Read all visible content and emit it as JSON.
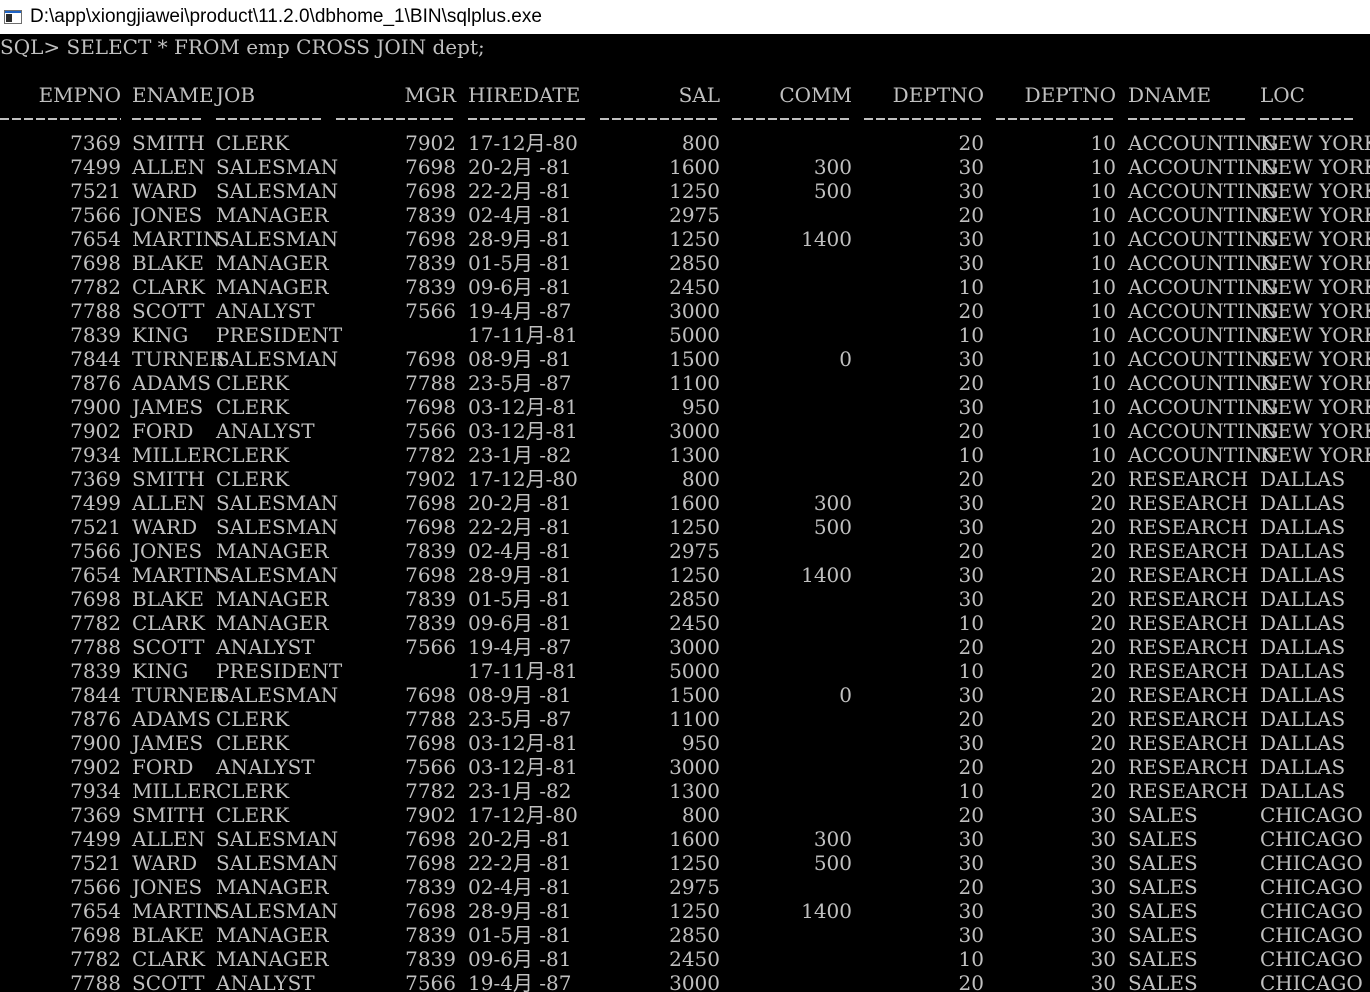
{
  "window": {
    "title": "D:\\app\\xiongjiawei\\product\\11.2.0\\dbhome_1\\BIN\\sqlplus.exe",
    "icon": "console-window-icon",
    "background": "#000000",
    "text_color": "#c0c0c0"
  },
  "console": {
    "prompt_line": "SQL> SELECT * FROM emp CROSS JOIN dept;",
    "headers": [
      "EMPNO",
      "ENAME",
      "JOB",
      "MGR",
      "HIREDATE",
      "SAL",
      "COMM",
      "DEPTNO",
      "DEPTNO",
      "DNAME",
      "LOC"
    ],
    "rows": [
      [
        "7369",
        "SMITH",
        "CLERK",
        "7902",
        "17-12月-80",
        "800",
        "",
        "20",
        "10",
        "ACCOUNTING",
        "NEW YORK"
      ],
      [
        "7499",
        "ALLEN",
        "SALESMAN",
        "7698",
        "20-2月 -81",
        "1600",
        "300",
        "30",
        "10",
        "ACCOUNTING",
        "NEW YORK"
      ],
      [
        "7521",
        "WARD",
        "SALESMAN",
        "7698",
        "22-2月 -81",
        "1250",
        "500",
        "30",
        "10",
        "ACCOUNTING",
        "NEW YORK"
      ],
      [
        "7566",
        "JONES",
        "MANAGER",
        "7839",
        "02-4月 -81",
        "2975",
        "",
        "20",
        "10",
        "ACCOUNTING",
        "NEW YORK"
      ],
      [
        "7654",
        "MARTIN",
        "SALESMAN",
        "7698",
        "28-9月 -81",
        "1250",
        "1400",
        "30",
        "10",
        "ACCOUNTING",
        "NEW YORK"
      ],
      [
        "7698",
        "BLAKE",
        "MANAGER",
        "7839",
        "01-5月 -81",
        "2850",
        "",
        "30",
        "10",
        "ACCOUNTING",
        "NEW YORK"
      ],
      [
        "7782",
        "CLARK",
        "MANAGER",
        "7839",
        "09-6月 -81",
        "2450",
        "",
        "10",
        "10",
        "ACCOUNTING",
        "NEW YORK"
      ],
      [
        "7788",
        "SCOTT",
        "ANALYST",
        "7566",
        "19-4月 -87",
        "3000",
        "",
        "20",
        "10",
        "ACCOUNTING",
        "NEW YORK"
      ],
      [
        "7839",
        "KING",
        "PRESIDENT",
        "",
        "17-11月-81",
        "5000",
        "",
        "10",
        "10",
        "ACCOUNTING",
        "NEW YORK"
      ],
      [
        "7844",
        "TURNER",
        "SALESMAN",
        "7698",
        "08-9月 -81",
        "1500",
        "0",
        "30",
        "10",
        "ACCOUNTING",
        "NEW YORK"
      ],
      [
        "7876",
        "ADAMS",
        "CLERK",
        "7788",
        "23-5月 -87",
        "1100",
        "",
        "20",
        "10",
        "ACCOUNTING",
        "NEW YORK"
      ],
      [
        "7900",
        "JAMES",
        "CLERK",
        "7698",
        "03-12月-81",
        "950",
        "",
        "30",
        "10",
        "ACCOUNTING",
        "NEW YORK"
      ],
      [
        "7902",
        "FORD",
        "ANALYST",
        "7566",
        "03-12月-81",
        "3000",
        "",
        "20",
        "10",
        "ACCOUNTING",
        "NEW YORK"
      ],
      [
        "7934",
        "MILLER",
        "CLERK",
        "7782",
        "23-1月 -82",
        "1300",
        "",
        "10",
        "10",
        "ACCOUNTING",
        "NEW YORK"
      ],
      [
        "7369",
        "SMITH",
        "CLERK",
        "7902",
        "17-12月-80",
        "800",
        "",
        "20",
        "20",
        "RESEARCH",
        "DALLAS"
      ],
      [
        "7499",
        "ALLEN",
        "SALESMAN",
        "7698",
        "20-2月 -81",
        "1600",
        "300",
        "30",
        "20",
        "RESEARCH",
        "DALLAS"
      ],
      [
        "7521",
        "WARD",
        "SALESMAN",
        "7698",
        "22-2月 -81",
        "1250",
        "500",
        "30",
        "20",
        "RESEARCH",
        "DALLAS"
      ],
      [
        "7566",
        "JONES",
        "MANAGER",
        "7839",
        "02-4月 -81",
        "2975",
        "",
        "20",
        "20",
        "RESEARCH",
        "DALLAS"
      ],
      [
        "7654",
        "MARTIN",
        "SALESMAN",
        "7698",
        "28-9月 -81",
        "1250",
        "1400",
        "30",
        "20",
        "RESEARCH",
        "DALLAS"
      ],
      [
        "7698",
        "BLAKE",
        "MANAGER",
        "7839",
        "01-5月 -81",
        "2850",
        "",
        "30",
        "20",
        "RESEARCH",
        "DALLAS"
      ],
      [
        "7782",
        "CLARK",
        "MANAGER",
        "7839",
        "09-6月 -81",
        "2450",
        "",
        "10",
        "20",
        "RESEARCH",
        "DALLAS"
      ],
      [
        "7788",
        "SCOTT",
        "ANALYST",
        "7566",
        "19-4月 -87",
        "3000",
        "",
        "20",
        "20",
        "RESEARCH",
        "DALLAS"
      ],
      [
        "7839",
        "KING",
        "PRESIDENT",
        "",
        "17-11月-81",
        "5000",
        "",
        "10",
        "20",
        "RESEARCH",
        "DALLAS"
      ],
      [
        "7844",
        "TURNER",
        "SALESMAN",
        "7698",
        "08-9月 -81",
        "1500",
        "0",
        "30",
        "20",
        "RESEARCH",
        "DALLAS"
      ],
      [
        "7876",
        "ADAMS",
        "CLERK",
        "7788",
        "23-5月 -87",
        "1100",
        "",
        "20",
        "20",
        "RESEARCH",
        "DALLAS"
      ],
      [
        "7900",
        "JAMES",
        "CLERK",
        "7698",
        "03-12月-81",
        "950",
        "",
        "30",
        "20",
        "RESEARCH",
        "DALLAS"
      ],
      [
        "7902",
        "FORD",
        "ANALYST",
        "7566",
        "03-12月-81",
        "3000",
        "",
        "20",
        "20",
        "RESEARCH",
        "DALLAS"
      ],
      [
        "7934",
        "MILLER",
        "CLERK",
        "7782",
        "23-1月 -82",
        "1300",
        "",
        "10",
        "20",
        "RESEARCH",
        "DALLAS"
      ],
      [
        "7369",
        "SMITH",
        "CLERK",
        "7902",
        "17-12月-80",
        "800",
        "",
        "20",
        "30",
        "SALES",
        "CHICAGO"
      ],
      [
        "7499",
        "ALLEN",
        "SALESMAN",
        "7698",
        "20-2月 -81",
        "1600",
        "300",
        "30",
        "30",
        "SALES",
        "CHICAGO"
      ],
      [
        "7521",
        "WARD",
        "SALESMAN",
        "7698",
        "22-2月 -81",
        "1250",
        "500",
        "30",
        "30",
        "SALES",
        "CHICAGO"
      ],
      [
        "7566",
        "JONES",
        "MANAGER",
        "7839",
        "02-4月 -81",
        "2975",
        "",
        "20",
        "30",
        "SALES",
        "CHICAGO"
      ],
      [
        "7654",
        "MARTIN",
        "SALESMAN",
        "7698",
        "28-9月 -81",
        "1250",
        "1400",
        "30",
        "30",
        "SALES",
        "CHICAGO"
      ],
      [
        "7698",
        "BLAKE",
        "MANAGER",
        "7839",
        "01-5月 -81",
        "2850",
        "",
        "30",
        "30",
        "SALES",
        "CHICAGO"
      ],
      [
        "7782",
        "CLARK",
        "MANAGER",
        "7839",
        "09-6月 -81",
        "2450",
        "",
        "10",
        "30",
        "SALES",
        "CHICAGO"
      ],
      [
        "7788",
        "SCOTT",
        "ANALYST",
        "7566",
        "19-4月 -87",
        "3000",
        "",
        "20",
        "30",
        "SALES",
        "CHICAGO"
      ]
    ]
  }
}
